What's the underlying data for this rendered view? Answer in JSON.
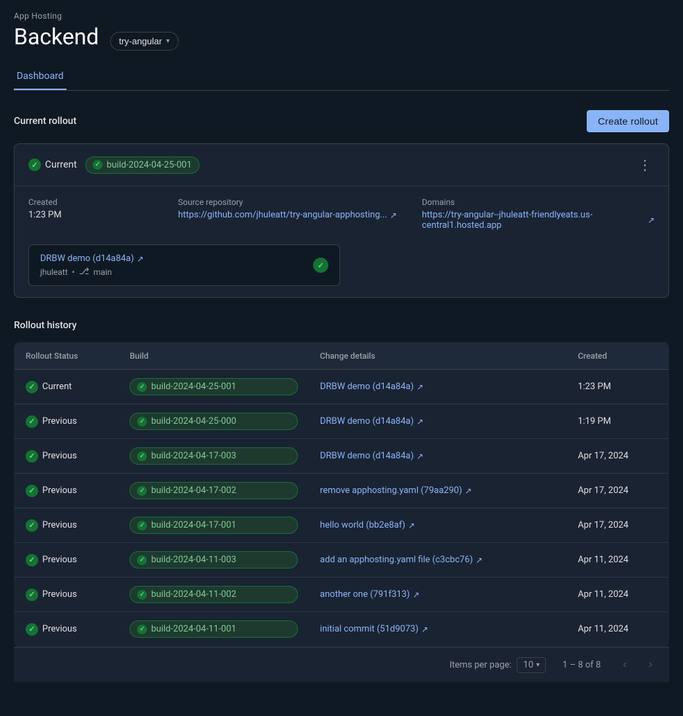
{
  "page": {
    "app_hosting_label": "App Hosting",
    "backend_title": "Backend",
    "branch_selector": "try-angular",
    "tabs": [
      {
        "id": "dashboard",
        "label": "Dashboard",
        "active": true
      }
    ]
  },
  "current_rollout": {
    "section_title": "Current rollout",
    "create_button_label": "Create rollout",
    "status": "Current",
    "build_id": "build-2024-04-25-001",
    "created_label": "Created",
    "created_value": "1:23 PM",
    "source_repo_label": "Source repository",
    "source_repo_url": "https://github.com/jhuleatt/try-angular-apphosting",
    "source_repo_display": "https://github.com/jhuleatt/try-angular-apphosting...",
    "domains_label": "Domains",
    "domain_url": "https://try-angular--jhuleatt-friendlyeats.us-central1.hosted.app",
    "domain_display": "https://try-angular--jhuleatt-friendlyeats.us-central1.hosted.app",
    "commit_link_text": "DRBW demo (d14a84a)",
    "commit_author": "jhuleatt",
    "commit_branch": "main",
    "more_icon": "⋮"
  },
  "rollout_history": {
    "section_title": "Rollout history",
    "columns": [
      "Rollout Status",
      "Build",
      "Change details",
      "Created"
    ],
    "rows": [
      {
        "status": "Current",
        "build": "build-2024-04-25-001",
        "change_details": "DRBW demo (d14a84a)",
        "change_link": true,
        "created": "1:23 PM"
      },
      {
        "status": "Previous",
        "build": "build-2024-04-25-000",
        "change_details": "DRBW demo (d14a84a)",
        "change_link": true,
        "created": "1:19 PM"
      },
      {
        "status": "Previous",
        "build": "build-2024-04-17-003",
        "change_details": "DRBW demo (d14a84a)",
        "change_link": true,
        "created": "Apr 17, 2024"
      },
      {
        "status": "Previous",
        "build": "build-2024-04-17-002",
        "change_details": "remove apphosting.yaml (79aa290)",
        "change_link": true,
        "created": "Apr 17, 2024"
      },
      {
        "status": "Previous",
        "build": "build-2024-04-17-001",
        "change_details": "hello world (bb2e8af)",
        "change_link": true,
        "created": "Apr 17, 2024"
      },
      {
        "status": "Previous",
        "build": "build-2024-04-11-003",
        "change_details": "add an apphosting.yaml file (c3cbc76)",
        "change_link": true,
        "created": "Apr 11, 2024"
      },
      {
        "status": "Previous",
        "build": "build-2024-04-11-002",
        "change_details": "another one (791f313)",
        "change_link": true,
        "created": "Apr 11, 2024"
      },
      {
        "status": "Previous",
        "build": "build-2024-04-11-001",
        "change_details": "initial commit (51d9073)",
        "change_link": true,
        "created": "Apr 11, 2024"
      }
    ],
    "pagination": {
      "items_per_page_label": "Items per page:",
      "items_per_page_value": "10",
      "range_text": "1 – 8 of 8"
    }
  }
}
